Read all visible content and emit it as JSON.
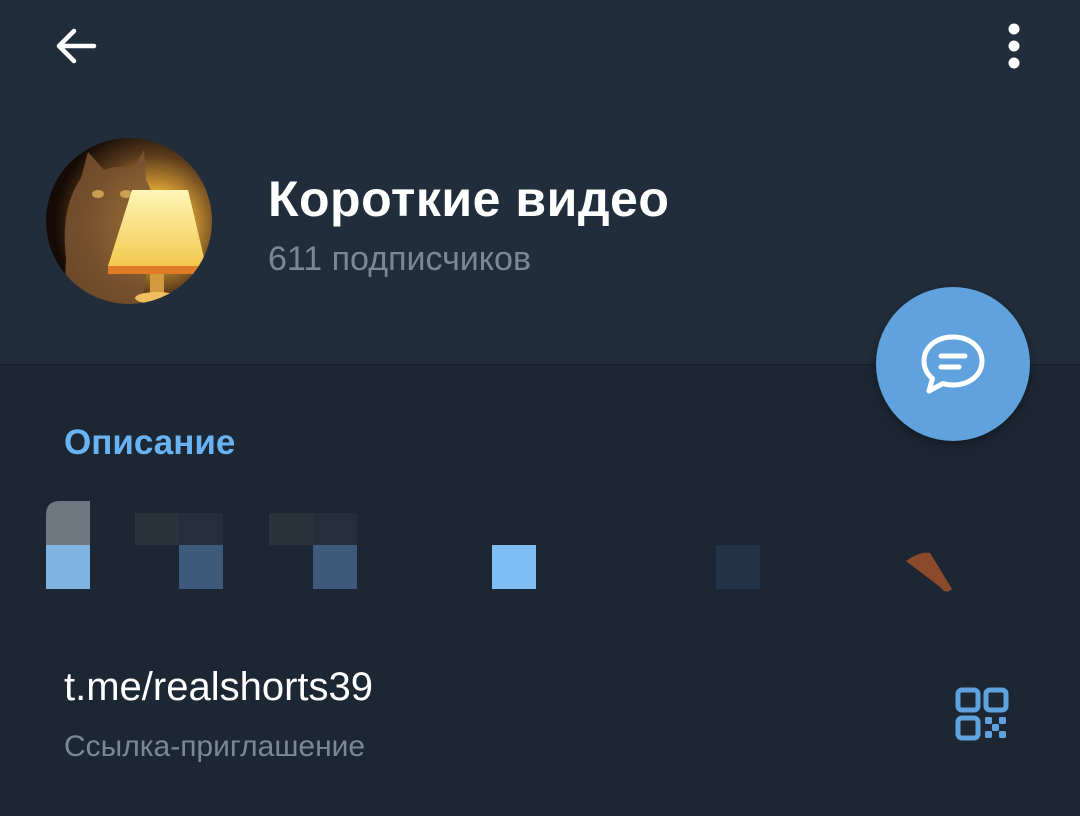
{
  "header": {
    "back_icon": "arrow-left-icon",
    "more_icon": "more-vertical-icon",
    "title": "Короткие видео",
    "subtitle": "611 подписчиков",
    "avatar": "cat-with-lamp-photo"
  },
  "fab": {
    "icon": "chat-bubble-icon",
    "color": "#5fa2dd"
  },
  "info": {
    "description_label": "Описание",
    "description_text_obscured": true,
    "link": "t.me/realshorts39",
    "link_caption": "Ссылка-приглашение",
    "qr_icon": "qr-code-icon"
  },
  "colors": {
    "header_bg": "#212d3b",
    "body_bg": "#1d2733",
    "accent": "#6ab3f3",
    "secondary_text": "#788896"
  }
}
